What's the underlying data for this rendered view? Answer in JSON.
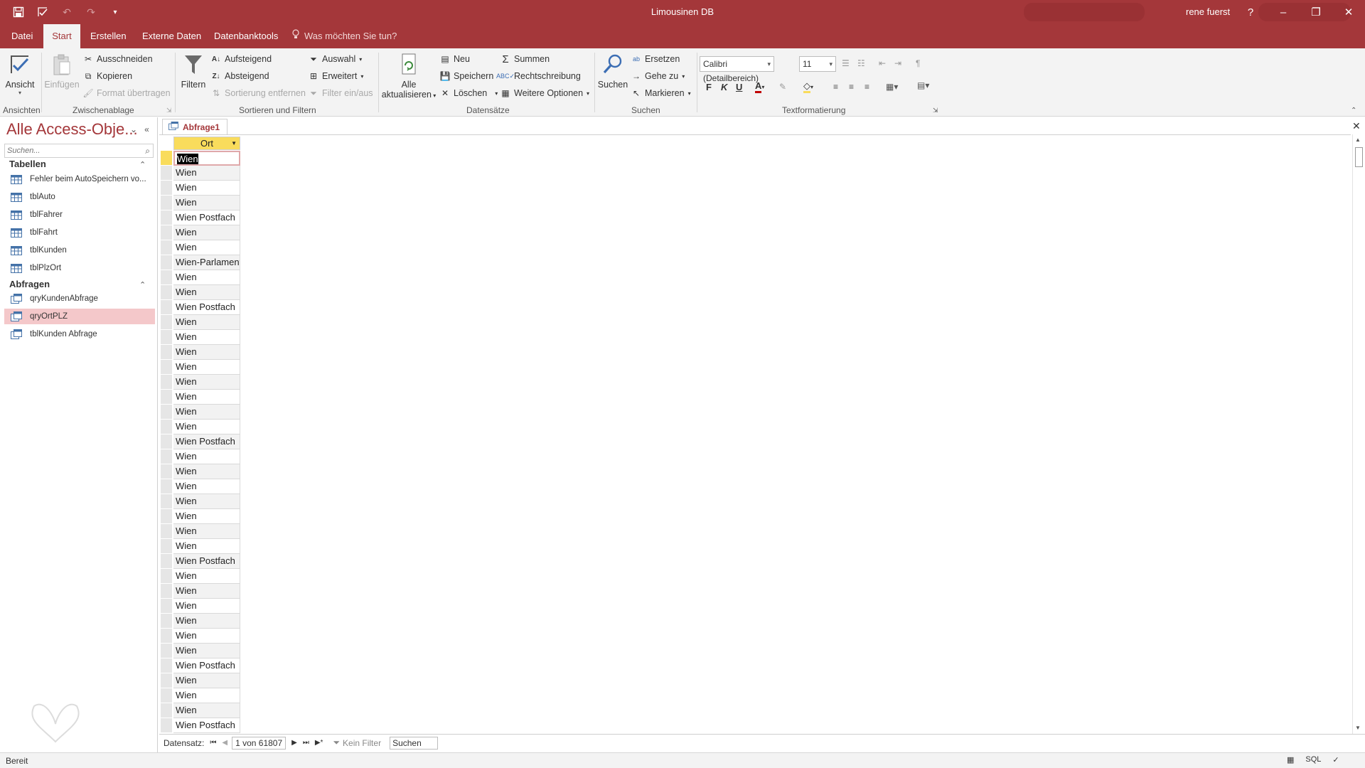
{
  "window": {
    "title": "Limousinen DB",
    "user": "rene fuerst",
    "help": "?",
    "minimize": "–",
    "restore": "❐",
    "close": "✕"
  },
  "tabs": [
    {
      "label": "Datei"
    },
    {
      "label": "Start"
    },
    {
      "label": "Erstellen"
    },
    {
      "label": "Externe Daten"
    },
    {
      "label": "Datenbanktools"
    }
  ],
  "tell_me": "Was möchten Sie tun?",
  "ribbon": {
    "ansichten": {
      "view": "Ansicht",
      "group": "Ansichten"
    },
    "zwischenablage": {
      "paste": "Einfügen",
      "cut": "Ausschneiden",
      "copy": "Kopieren",
      "format_painter": "Format übertragen",
      "group": "Zwischenablage"
    },
    "sortieren": {
      "filter": "Filtern",
      "ascending": "Aufsteigend",
      "descending": "Absteigend",
      "remove_sort": "Sortierung entfernen",
      "selection": "Auswahl",
      "advanced": "Erweitert",
      "toggle_filter": "Filter ein/aus",
      "group": "Sortieren und Filtern"
    },
    "datensaetze": {
      "refresh_all_1": "Alle",
      "refresh_all_2": "aktualisieren",
      "new": "Neu",
      "save": "Speichern",
      "delete": "Löschen",
      "totals": "Summen",
      "spelling": "Rechtschreibung",
      "more": "Weitere Optionen",
      "group": "Datensätze"
    },
    "suchen": {
      "find": "Suchen",
      "replace": "Ersetzen",
      "goto": "Gehe zu",
      "select": "Markieren",
      "group": "Suchen"
    },
    "text": {
      "font": "Calibri (Detailbereich)",
      "size": "11",
      "bold": "F",
      "italic": "K",
      "underline": "U",
      "group": "Textformatierung"
    }
  },
  "nav": {
    "title": "Alle Access-Obje...",
    "search_placeholder": "Suchen...",
    "groups": [
      {
        "label": "Tabellen",
        "items": [
          "Fehler beim AutoSpeichern vo...",
          "tblAuto",
          "tblFahrer",
          "tblFahrt",
          "tblKunden",
          "tblPlzOrt"
        ]
      },
      {
        "label": "Abfragen",
        "items": [
          "qryKundenAbfrage",
          "qryOrtPLZ",
          "tblKunden Abfrage"
        ]
      }
    ],
    "selected_item": "qryOrtPLZ"
  },
  "document": {
    "tab": "Abfrage1",
    "column": "Ort",
    "rows": [
      "Wien",
      "Wien",
      "Wien",
      "Wien",
      "Wien Postfach",
      "Wien",
      "Wien",
      "Wien-Parlament",
      "Wien",
      "Wien",
      "Wien Postfach",
      "Wien",
      "Wien",
      "Wien",
      "Wien",
      "Wien",
      "Wien",
      "Wien",
      "Wien",
      "Wien Postfach",
      "Wien",
      "Wien",
      "Wien",
      "Wien",
      "Wien",
      "Wien",
      "Wien",
      "Wien Postfach",
      "Wien",
      "Wien",
      "Wien",
      "Wien",
      "Wien",
      "Wien",
      "Wien Postfach",
      "Wien",
      "Wien",
      "Wien",
      "Wien Postfach",
      "Wien"
    ]
  },
  "record_nav": {
    "label": "Datensatz:",
    "position": "1 von 61807",
    "filter": "Kein Filter",
    "search": "Suchen"
  },
  "status": {
    "text": "Bereit",
    "sql": "SQL"
  },
  "colors": {
    "accent": "#a4373a",
    "header_yellow": "#f9dc5c",
    "selected_nav": "#f4c8ca"
  }
}
